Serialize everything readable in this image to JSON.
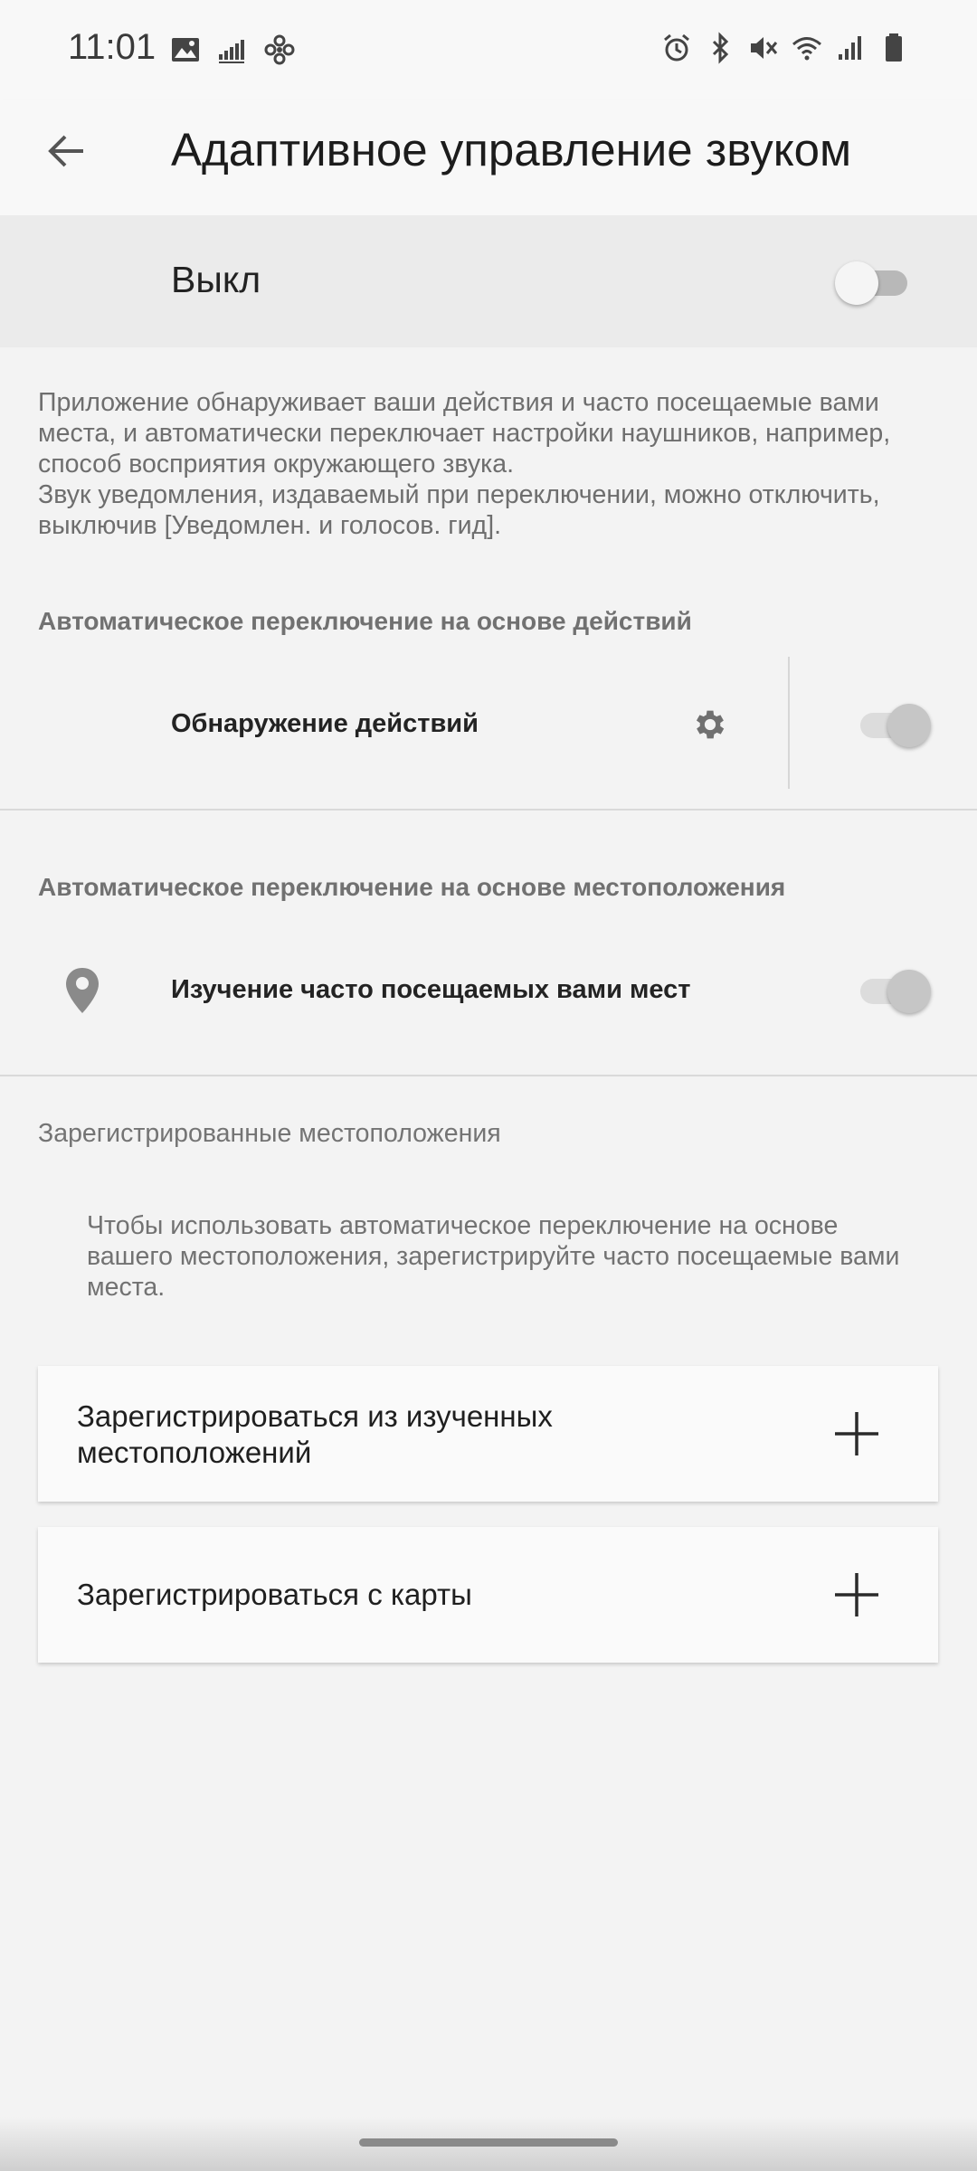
{
  "status": {
    "time": "11:01",
    "left_icons": [
      "image-icon",
      "bars-icon",
      "fan-icon"
    ],
    "right_icons": [
      "alarm-icon",
      "bluetooth-icon",
      "mute-icon",
      "wifi-icon",
      "signal-icon",
      "battery-icon"
    ]
  },
  "header": {
    "back_icon": "arrow-left-icon",
    "title": "Адаптивное управление звуком"
  },
  "master": {
    "label": "Выкл",
    "enabled": false
  },
  "description": {
    "line1": "Приложение обнаруживает ваши действия и часто посещаемые вами места, и автоматически переключает настройки наушников, например, способ восприятия окружающего звука.",
    "line2": "Звук уведомления, издаваемый при переключении, можно отключить, выключив [Уведомлен. и голосов. гид]."
  },
  "section_actions": {
    "header": "Автоматическое переключение на основе действий",
    "row_label": "Обнаружение действий",
    "settings_icon": "gear-icon",
    "enabled": true
  },
  "section_location": {
    "header": "Автоматическое переключение на основе местоположения",
    "row_icon": "location-pin-icon",
    "row_label": "Изучение часто посещаемых вами мест",
    "enabled": true
  },
  "registered": {
    "header": "Зарегистрированные местоположения",
    "hint": "Чтобы использовать автоматическое переключение на основе вашего местоположения, зарегистрируйте часто посещаемые вами места.",
    "cards": [
      {
        "label": "Зарегистрироваться из изученных местоположений",
        "icon": "plus-icon"
      },
      {
        "label": "Зарегистрироваться с карты",
        "icon": "plus-icon"
      }
    ]
  },
  "colors": {
    "background": "#f3f3f3",
    "master_row": "#ebebeb",
    "toggle_disabled": "#c6c6c6"
  }
}
